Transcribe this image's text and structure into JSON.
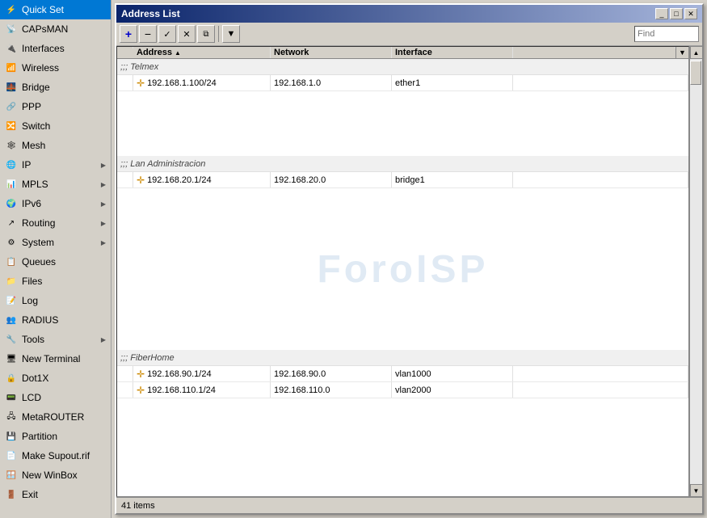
{
  "sidebar": {
    "items": [
      {
        "id": "quick-set",
        "label": "Quick Set",
        "icon": "⚡",
        "has_arrow": false
      },
      {
        "id": "capsman",
        "label": "CAPsMAN",
        "icon": "📡",
        "has_arrow": false
      },
      {
        "id": "interfaces",
        "label": "Interfaces",
        "icon": "🔌",
        "has_arrow": false
      },
      {
        "id": "wireless",
        "label": "Wireless",
        "icon": "📶",
        "has_arrow": false
      },
      {
        "id": "bridge",
        "label": "Bridge",
        "icon": "🌉",
        "has_arrow": false
      },
      {
        "id": "ppp",
        "label": "PPP",
        "icon": "🔗",
        "has_arrow": false
      },
      {
        "id": "switch",
        "label": "Switch",
        "icon": "🔀",
        "has_arrow": false
      },
      {
        "id": "mesh",
        "label": "Mesh",
        "icon": "🕸",
        "has_arrow": false
      },
      {
        "id": "ip",
        "label": "IP",
        "icon": "🌐",
        "has_arrow": true
      },
      {
        "id": "mpls",
        "label": "MPLS",
        "icon": "📊",
        "has_arrow": true
      },
      {
        "id": "ipv6",
        "label": "IPv6",
        "icon": "🌍",
        "has_arrow": true
      },
      {
        "id": "routing",
        "label": "Routing",
        "icon": "↗",
        "has_arrow": true
      },
      {
        "id": "system",
        "label": "System",
        "icon": "⚙",
        "has_arrow": true
      },
      {
        "id": "queues",
        "label": "Queues",
        "icon": "📋",
        "has_arrow": false
      },
      {
        "id": "files",
        "label": "Files",
        "icon": "📁",
        "has_arrow": false
      },
      {
        "id": "log",
        "label": "Log",
        "icon": "📝",
        "has_arrow": false
      },
      {
        "id": "radius",
        "label": "RADIUS",
        "icon": "👥",
        "has_arrow": false
      },
      {
        "id": "tools",
        "label": "Tools",
        "icon": "🔧",
        "has_arrow": true
      },
      {
        "id": "new-terminal",
        "label": "New Terminal",
        "icon": "🖥",
        "has_arrow": false
      },
      {
        "id": "dot1x",
        "label": "Dot1X",
        "icon": "🔒",
        "has_arrow": false
      },
      {
        "id": "lcd",
        "label": "LCD",
        "icon": "📟",
        "has_arrow": false
      },
      {
        "id": "metarouter",
        "label": "MetaROUTER",
        "icon": "🖧",
        "has_arrow": false
      },
      {
        "id": "partition",
        "label": "Partition",
        "icon": "💾",
        "has_arrow": false
      },
      {
        "id": "make-supout",
        "label": "Make Supout.rif",
        "icon": "📄",
        "has_arrow": false
      },
      {
        "id": "new-winbox",
        "label": "New WinBox",
        "icon": "🪟",
        "has_arrow": false
      },
      {
        "id": "exit",
        "label": "Exit",
        "icon": "🚪",
        "has_arrow": false
      }
    ]
  },
  "window": {
    "title": "Address List",
    "controls": {
      "minimize": "_",
      "maximize": "□",
      "close": "✕"
    }
  },
  "toolbar": {
    "add_label": "+",
    "remove_label": "−",
    "check_label": "✓",
    "uncheck_label": "✕",
    "copy_label": "⧉",
    "filter_label": "▼",
    "find_placeholder": "Find"
  },
  "table": {
    "columns": [
      {
        "id": "address",
        "label": "Address",
        "sortable": true
      },
      {
        "id": "network",
        "label": "Network"
      },
      {
        "id": "interface",
        "label": "Interface"
      },
      {
        "id": "extra",
        "label": ""
      }
    ],
    "groups": [
      {
        "name": ";;; Telmex",
        "rows": [
          {
            "address": "192.168.1.100/24",
            "network": "192.168.1.0",
            "interface": "ether1",
            "extra": ""
          }
        ]
      },
      {
        "name": ";;; Lan Administracion",
        "rows": [
          {
            "address": "192.168.20.1/24",
            "network": "192.168.20.0",
            "interface": "bridge1",
            "extra": ""
          }
        ]
      },
      {
        "name": ";;; FiberHome",
        "rows": [
          {
            "address": "192.168.90.1/24",
            "network": "192.168.90.0",
            "interface": "vlan1000",
            "extra": ""
          },
          {
            "address": "192.168.110.1/24",
            "network": "192.168.110.0",
            "interface": "vlan2000",
            "extra": ""
          }
        ]
      }
    ]
  },
  "statusbar": {
    "text": "41 items"
  },
  "watermark": {
    "text": "ForoISP"
  }
}
